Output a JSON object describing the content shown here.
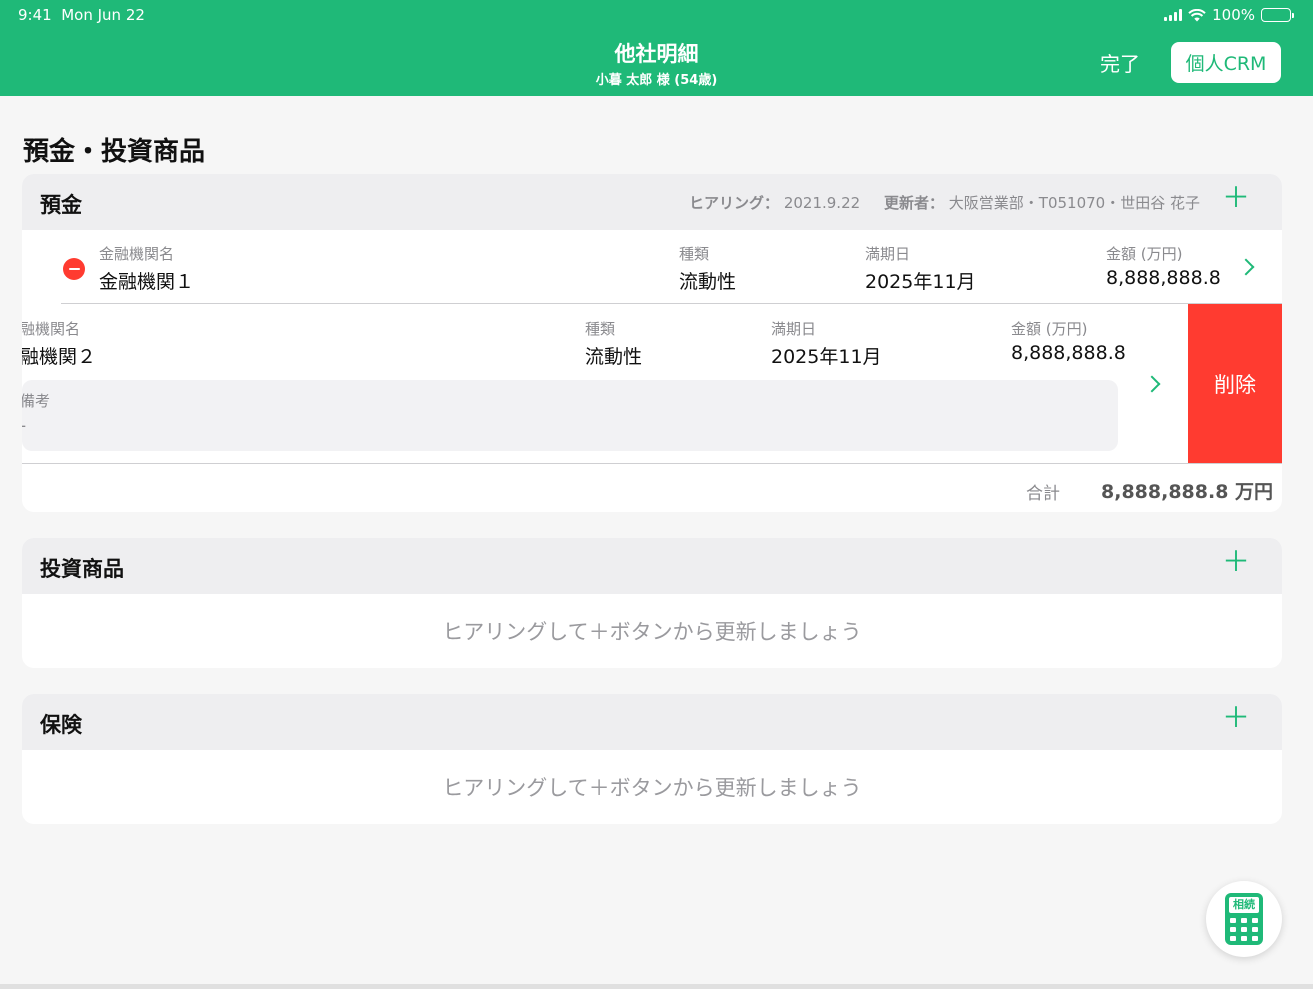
{
  "status": {
    "time": "9:41",
    "date": "Mon Jun 22",
    "battery": "100%"
  },
  "nav": {
    "title": "他社明細",
    "subtitle": "小暮 太郎 様 (54歳)",
    "done": "完了",
    "crm": "個人CRM"
  },
  "page": {
    "heading": "預金・投資商品"
  },
  "deposit": {
    "title": "預金",
    "hearing_label": "ヒアリング：",
    "hearing_date": "2021.9.22",
    "updater_label": "更新者：",
    "updater": "大阪営業部・T051070・世田谷 花子",
    "row1": {
      "name_label": "金融機関名",
      "name": "金融機関１",
      "type_label": "種類",
      "type": "流動性",
      "maturity_label": "満期日",
      "maturity": "2025年11月",
      "amount_label": "金額 (万円)",
      "amount": "8,888,888.8"
    },
    "row2": {
      "name_label": "融機関名",
      "name": "融機関２",
      "type_label": "種類",
      "type": "流動性",
      "maturity_label": "満期日",
      "maturity": "2025年11月",
      "amount_label": "金額 (万円)",
      "amount": "8,888,888.8",
      "remark_label": "備考",
      "remark": "-",
      "delete": "削除"
    },
    "total_label": "合計",
    "total_value": "8,888,888.8 万円"
  },
  "investment": {
    "title": "投資商品",
    "empty": "ヒアリングして＋ボタンから更新しましょう"
  },
  "insurance": {
    "title": "保険",
    "empty": "ヒアリングして＋ボタンから更新しましょう"
  },
  "fab": {
    "label": "相続",
    "icon": "calculator-icon"
  },
  "icons": {
    "add": "＋"
  },
  "colors": {
    "accent": "#1fb978",
    "delete": "#ff3b30",
    "header_bg": "#eeeef0"
  }
}
